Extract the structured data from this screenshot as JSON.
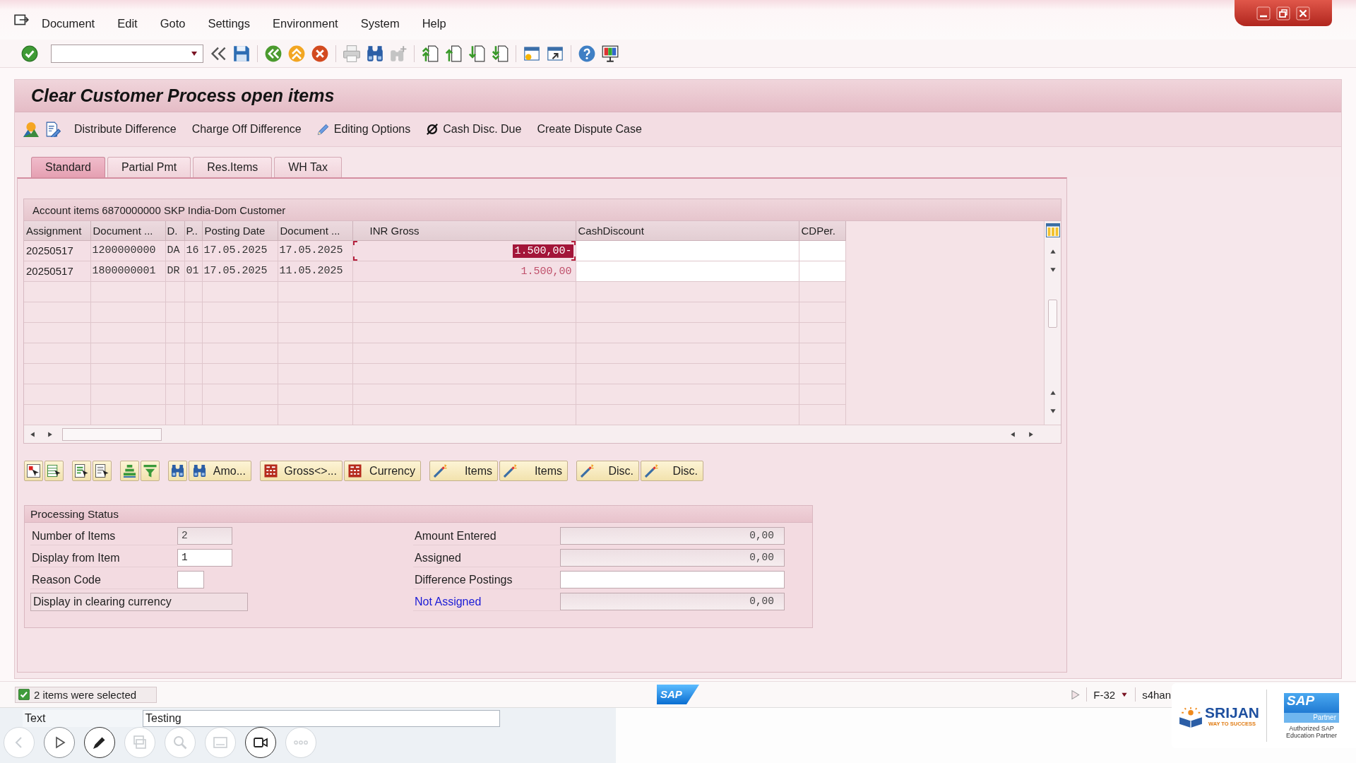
{
  "window": {
    "menu": [
      "Document",
      "Edit",
      "Goto",
      "Settings",
      "Environment",
      "System",
      "Help"
    ]
  },
  "title": "Clear Customer Process open items",
  "app_toolbar": {
    "buttons": [
      {
        "label": "Distribute Difference"
      },
      {
        "label": "Charge Off Difference"
      },
      {
        "label": "Editing Options"
      },
      {
        "label": "Cash Disc. Due"
      },
      {
        "label": "Create Dispute Case"
      }
    ]
  },
  "tabs": [
    {
      "label": "Standard",
      "selected": true
    },
    {
      "label": "Partial Pmt",
      "selected": false
    },
    {
      "label": "Res.Items",
      "selected": false
    },
    {
      "label": "WH Tax",
      "selected": false
    }
  ],
  "table": {
    "title": "Account items 6870000000 SKP India-Dom Customer",
    "columns": [
      "Assignment",
      "Document ...",
      "D.",
      "P..",
      "Posting Date",
      "Document ...",
      "INR Gross",
      "CashDiscount",
      "CDPer."
    ],
    "rows": [
      {
        "cells": [
          "20250517",
          "1200000000",
          "DA",
          "16",
          "17.05.2025",
          "17.05.2025",
          "1.500,00-"
        ],
        "amount_selected": true
      },
      {
        "cells": [
          "20250517",
          "1800000001",
          "DR",
          "01",
          "17.05.2025",
          "11.05.2025",
          "1.500,00"
        ],
        "amount_selected": false
      }
    ]
  },
  "item_toolbar": {
    "buttons": [
      {
        "label": "Amo..."
      },
      {
        "label": "Gross<>..."
      },
      {
        "label": "Currency"
      },
      {
        "label": "Items"
      },
      {
        "label": "Items"
      },
      {
        "label": "Disc."
      },
      {
        "label": "Disc."
      }
    ]
  },
  "processing_status": {
    "title": "Processing Status",
    "left_fields": [
      {
        "label": "Number of Items",
        "value": "2",
        "editable": false
      },
      {
        "label": "Display from Item",
        "value": "1",
        "editable": true
      },
      {
        "label": "Reason Code",
        "editable": true
      }
    ],
    "currency_button": "Display in clearing currency",
    "right_fields": [
      {
        "label": "Amount Entered",
        "value": "0,00",
        "editable": false,
        "kind": "label"
      },
      {
        "label": "Assigned",
        "value": "0,00",
        "editable": false,
        "kind": "label"
      },
      {
        "label": "Difference Postings",
        "editable": true,
        "kind": "label"
      },
      {
        "label": "Not Assigned",
        "value": "0,00",
        "editable": false,
        "kind": "link"
      }
    ]
  },
  "status_bar": {
    "message": "2 items were selected",
    "kind": "success",
    "logo": "SAP",
    "transaction": "F-32",
    "system": "s4han"
  },
  "text_row": {
    "label": "Text",
    "value": "Testing"
  },
  "partner_logo": {
    "brand": "SRIJAN",
    "tagline": "WAY TO SUCCESS",
    "badge": "SAP",
    "badge_subtitle": "Partner",
    "caption": "Authorized SAP Education Partner"
  }
}
